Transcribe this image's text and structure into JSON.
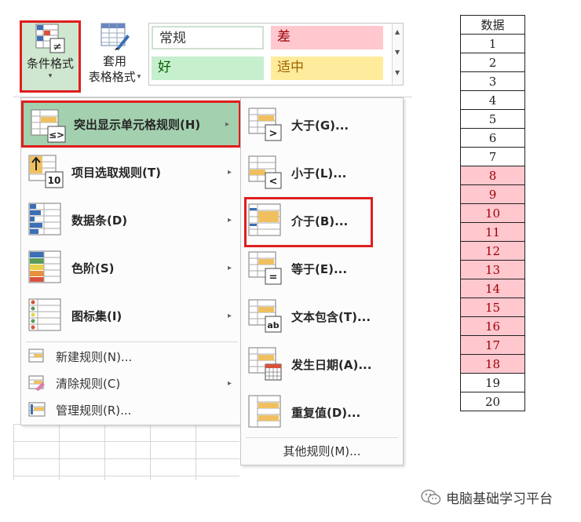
{
  "ribbon": {
    "conditional_formatting_label": "条件格式",
    "conditional_formatting_caret": "▾",
    "format_as_table_line1": "套用",
    "format_as_table_line2": "表格格式",
    "format_as_table_caret": "▾",
    "styles": {
      "normal": "常规",
      "bad": "差",
      "good": "好",
      "neutral": "适中"
    },
    "style_colors": {
      "bad_bg": "#ffc7ce",
      "good_bg": "#c6efce",
      "neutral_bg": "#ffeb9c"
    }
  },
  "menu": {
    "items": [
      {
        "label": "突出显示单元格规则(H)",
        "has_submenu": true,
        "icon": "highlight-cells-rules-icon"
      },
      {
        "label": "项目选取规则(T)",
        "has_submenu": true,
        "icon": "top-bottom-rules-icon"
      },
      {
        "label": "数据条(D)",
        "has_submenu": true,
        "icon": "data-bars-icon"
      },
      {
        "label": "色阶(S)",
        "has_submenu": true,
        "icon": "color-scales-icon"
      },
      {
        "label": "图标集(I)",
        "has_submenu": true,
        "icon": "icon-sets-icon"
      }
    ],
    "small_items": [
      {
        "label": "新建规则(N)...",
        "icon": "new-rule-icon"
      },
      {
        "label": "清除规则(C)",
        "icon": "clear-rules-icon"
      },
      {
        "label": "管理规则(R)...",
        "icon": "manage-rules-icon"
      }
    ]
  },
  "submenu": {
    "items": [
      {
        "label": "大于(G)...",
        "icon": "greater-than-icon"
      },
      {
        "label": "小于(L)...",
        "icon": "less-than-icon"
      },
      {
        "label": "介于(B)...",
        "icon": "between-icon"
      },
      {
        "label": "等于(E)...",
        "icon": "equal-to-icon"
      },
      {
        "label": "文本包含(T)...",
        "icon": "text-contains-icon"
      },
      {
        "label": "发生日期(A)...",
        "icon": "date-occurring-icon"
      },
      {
        "label": "重复值(D)...",
        "icon": "duplicate-values-icon"
      }
    ],
    "more_rules": "其他规则(M)..."
  },
  "table": {
    "header": "数据",
    "values": [
      "1",
      "2",
      "3",
      "4",
      "5",
      "6",
      "7",
      "8",
      "9",
      "10",
      "11",
      "12",
      "13",
      "14",
      "15",
      "16",
      "17",
      "18",
      "19",
      "20"
    ],
    "highlighted_from": 8,
    "highlighted_to": 18,
    "highlight_color": "#ffc7ce"
  },
  "watermark": "电脑基础学习平台",
  "arrow_glyph": "▸"
}
